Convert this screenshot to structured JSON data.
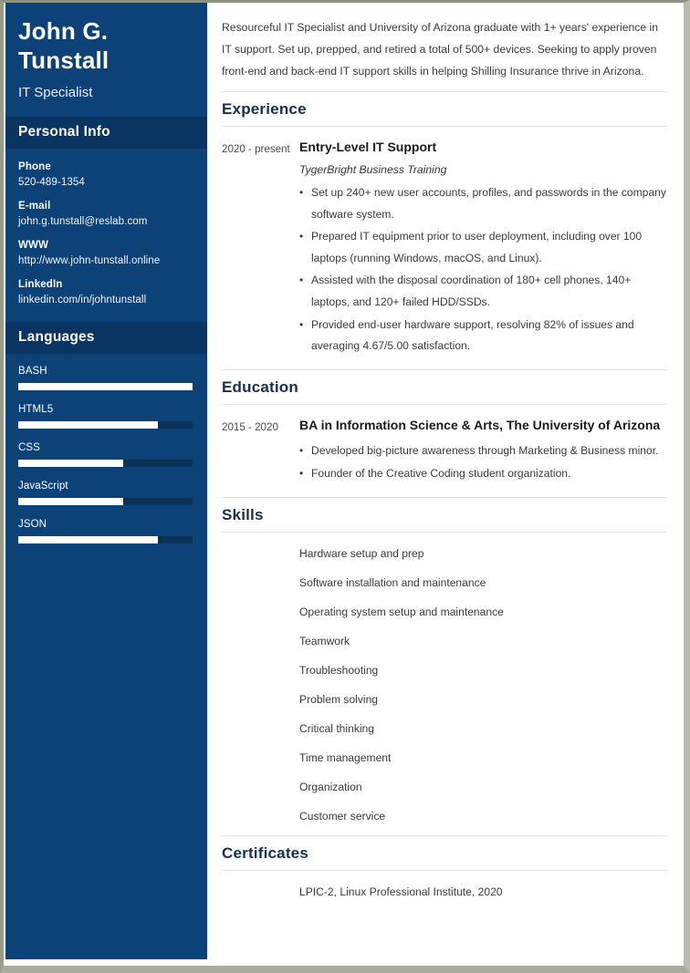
{
  "sidebar": {
    "full_name": "John G. Tunstall",
    "job_title": "IT Specialist",
    "personal_info_heading": "Personal Info",
    "contacts": [
      {
        "label": "Phone",
        "value": "520-489-1354"
      },
      {
        "label": "E-mail",
        "value": "john.g.tunstall@reslab.com"
      },
      {
        "label": "WWW",
        "value": "http://www.john-tunstall.online"
      },
      {
        "label": "LinkedIn",
        "value": "linkedin.com/in/johntunstall"
      }
    ],
    "languages_heading": "Languages",
    "languages": [
      {
        "name": "BASH",
        "level": 100
      },
      {
        "name": "HTML5",
        "level": 80
      },
      {
        "name": "CSS",
        "level": 60
      },
      {
        "name": "JavaScript",
        "level": 60
      },
      {
        "name": "JSON",
        "level": 80
      }
    ],
    "colors": {
      "background": "#0d4278",
      "heading_band": "#0a3462",
      "bar_track": "#0a3158",
      "bar_fill": "#ffffff"
    }
  },
  "main": {
    "summary": "Resourceful IT Specialist and University of Arizona graduate with 1+ years' experience in IT support. Set up, prepped, and retired a total of 500+ devices. Seeking to apply proven front-end and back-end IT support skills in helping Shilling Insurance thrive in Arizona.",
    "experience": {
      "heading": "Experience",
      "entries": [
        {
          "date": "2020 - present",
          "role": "Entry-Level IT Support",
          "org": "TygerBright Business Training",
          "bullets": [
            "Set up 240+ new user accounts, profiles, and passwords in the company software system.",
            "Prepared IT equipment prior to user deployment, including over 100 laptops (running Windows, macOS, and Linux).",
            "Assisted with the disposal coordination of 180+ cell phones, 140+ laptops, and 120+ failed HDD/SSDs.",
            "Provided end-user hardware support, resolving 82% of issues and averaging 4.67/5.00 satisfaction."
          ]
        }
      ]
    },
    "education": {
      "heading": "Education",
      "entries": [
        {
          "date": "2015 - 2020",
          "role": "BA in Information Science & Arts, The University of Arizona",
          "bullets": [
            "Developed big-picture awareness through Marketing & Business minor.",
            "Founder of the Creative Coding student organization."
          ]
        }
      ]
    },
    "skills": {
      "heading": "Skills",
      "items": [
        "Hardware setup and prep",
        "Software installation and maintenance",
        "Operating system setup and maintenance",
        "Teamwork",
        "Troubleshooting",
        "Problem solving",
        "Critical thinking",
        "Time management",
        "Organization",
        "Customer service"
      ]
    },
    "certificates": {
      "heading": "Certificates",
      "items": [
        "LPIC-2, Linux Professional Institute, 2020"
      ]
    },
    "colors": {
      "heading": "#14304f",
      "rule": "#e2e2e2",
      "body_text": "#3a3a3a"
    }
  }
}
